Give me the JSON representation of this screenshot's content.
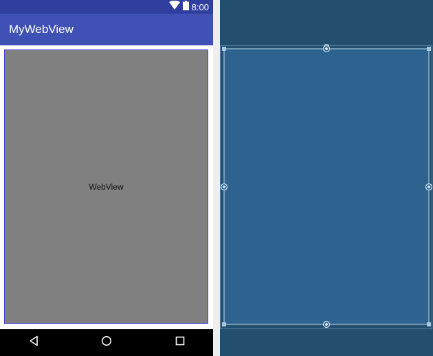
{
  "status_bar": {
    "time": "8:00",
    "icons": [
      "wifi-icon",
      "battery-icon"
    ]
  },
  "app_bar": {
    "title": "MyWebView"
  },
  "webview": {
    "label": "WebView"
  },
  "nav_bar": {
    "icons": [
      "back-icon",
      "home-icon",
      "recents-icon"
    ]
  },
  "colors": {
    "status_bar": "#303f9f",
    "app_bar": "#3f51b5",
    "webview_fill": "#808080",
    "webview_border": "#3f3fd9",
    "blueprint_bg": "#244e6e",
    "blueprint_view": "#2e6390",
    "blueprint_line": "#a9c8e0"
  }
}
